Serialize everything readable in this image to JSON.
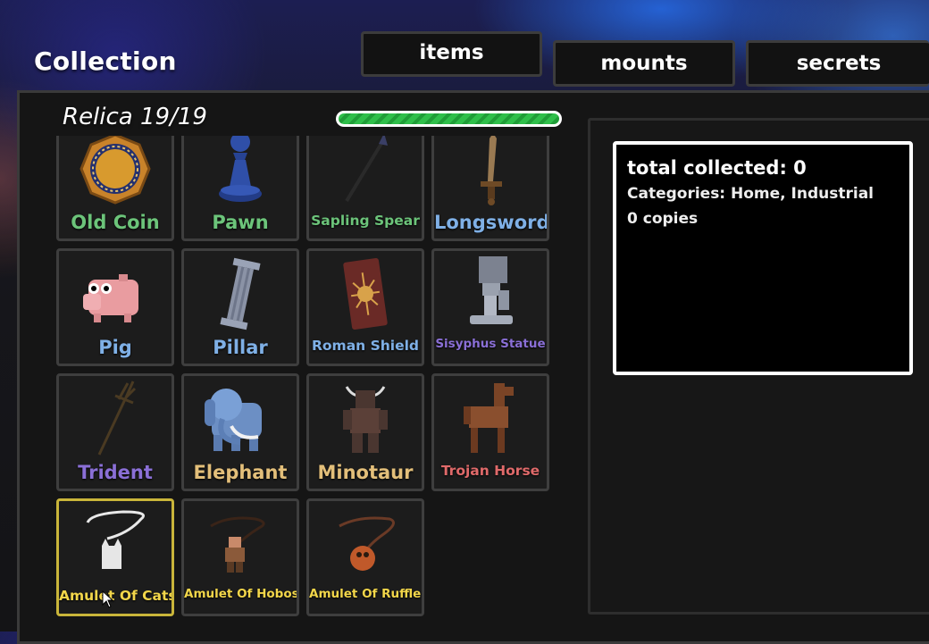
{
  "window": {
    "title": "Collection"
  },
  "tabs": [
    {
      "label": "items"
    },
    {
      "label": "mounts"
    },
    {
      "label": "secrets"
    }
  ],
  "collection": {
    "set_label": "Relica 19/19",
    "progress": 1.0,
    "progress_color": "#2fbf4a"
  },
  "items": [
    {
      "name": "Old Coin",
      "color": "#6cc47a",
      "icon": "coin-icon"
    },
    {
      "name": "Pawn",
      "color": "#6cc47a",
      "icon": "pawn-icon"
    },
    {
      "name": "Sapling Spear",
      "color": "#6cc47a",
      "icon": "spear-icon"
    },
    {
      "name": "Longsword",
      "color": "#7fb0e6",
      "icon": "sword-icon"
    },
    {
      "name": "Pig",
      "color": "#7fb0e6",
      "icon": "pig-icon"
    },
    {
      "name": "Pillar",
      "color": "#7fb0e6",
      "icon": "pillar-icon"
    },
    {
      "name": "Roman Shield",
      "color": "#7fb0e6",
      "icon": "shield-icon"
    },
    {
      "name": "Sisyphus Statue",
      "color": "#8a6fd6",
      "icon": "statue-icon"
    },
    {
      "name": "Trident",
      "color": "#8a6fd6",
      "icon": "trident-icon"
    },
    {
      "name": "Elephant",
      "color": "#e3bf7a",
      "icon": "elephant-icon"
    },
    {
      "name": "Minotaur",
      "color": "#e3bf7a",
      "icon": "minotaur-icon"
    },
    {
      "name": "Trojan Horse",
      "color": "#e06a6a",
      "icon": "horse-icon"
    },
    {
      "name": "Amulet Of Cats",
      "color": "#f2d64a",
      "icon": "amulet-cat-icon",
      "selected": true
    },
    {
      "name": "Amulet Of Hobos",
      "color": "#f2d64a",
      "icon": "amulet-hobo-icon"
    },
    {
      "name": "Amulet Of Ruffles",
      "color": "#f2d64a",
      "icon": "amulet-ruffles-icon"
    }
  ],
  "info": {
    "total_collected": "total collected: 0",
    "categories": "Categories: Home, Industrial",
    "copies": "0 copies"
  }
}
